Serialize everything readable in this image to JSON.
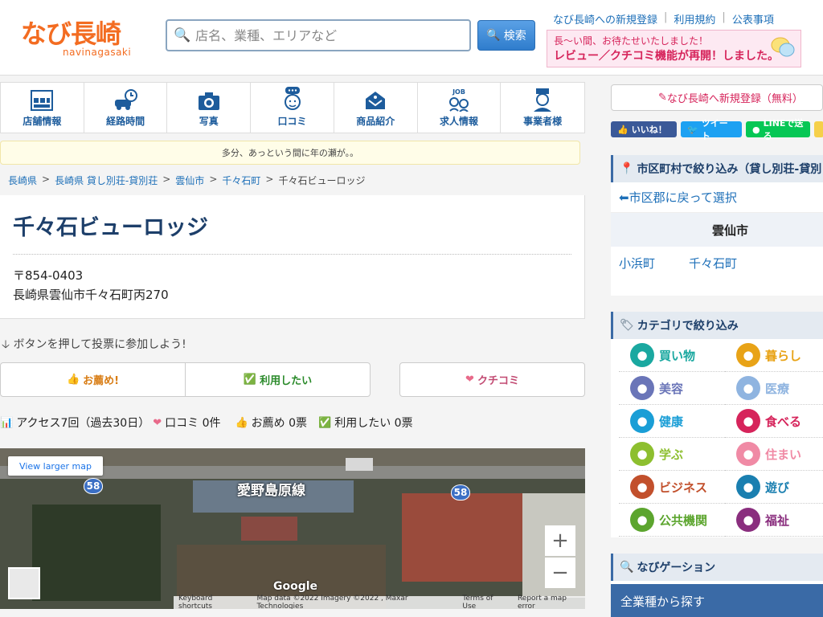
{
  "header": {
    "logo_main": "なび長崎",
    "logo_sub": "navinagasaki",
    "search_placeholder": "店名、業種、エリアなど",
    "search_button": "検索",
    "top_links": [
      "なび長崎への新規登録",
      "利用規約",
      "公表事項"
    ],
    "banner_line1": "長〜い間、お待たせいたしました！",
    "banner_line2": "レビュー／クチコミ機能が再開！しました。"
  },
  "catnav": [
    {
      "label": "店舗情報",
      "icon": "info-icon"
    },
    {
      "label": "経路時間",
      "icon": "car-clock-icon"
    },
    {
      "label": "写真",
      "icon": "camera-icon"
    },
    {
      "label": "口コミ",
      "icon": "speech-person-icon"
    },
    {
      "label": "商品紹介",
      "icon": "product-icon"
    },
    {
      "label": "求人情報",
      "icon": "job-icon"
    },
    {
      "label": "事業者様",
      "icon": "business-person-icon"
    }
  ],
  "notice": "多分、あっという間に年の瀬が。。",
  "breadcrumb": [
    "長崎県",
    "長崎県 貸し別荘-貸別荘",
    "雲仙市",
    "千々石町"
  ],
  "breadcrumb_current": "千々石ビューロッジ",
  "place": {
    "name": "千々石ビューロッジ",
    "zip": "〒854-0403",
    "address": "長崎県雲仙市千々石町丙270"
  },
  "vote": {
    "hint": "ボタンを押して投票に参加しよう!",
    "recommend": "お薦め!",
    "want_use": "利用したい",
    "kuchikomi": "クチコミ"
  },
  "stats": {
    "access": "アクセス7回（過去30日）",
    "kuchikomi": "口コミ 0件",
    "recommend": "お薦め 0票",
    "want_use": "利用したい 0票"
  },
  "map": {
    "larger": "View larger map",
    "road_label": "愛野島原線",
    "shield1": "58",
    "shield2": "58",
    "zoom_in": "+",
    "zoom_out": "−",
    "google": "Google",
    "footer": [
      "Keyboard shortcuts",
      "Map data ©2022 Imagery ©2022 , Maxar Technologies",
      "Terms of Use",
      "Report a map error"
    ]
  },
  "sidebar": {
    "register": "なび長崎へ新規登録（無料）",
    "social": [
      "いいね！",
      "ツイート",
      "LINEで送る"
    ],
    "area_head": "市区町村で絞り込み（貸し別荘-貸別",
    "back": "⬅市区郡に戻って選択",
    "city": "雲仙市",
    "towns": [
      "小浜町",
      "千々石町"
    ],
    "cat_head": "カテゴリで絞り込み",
    "categories": [
      {
        "label": "買い物",
        "color": "#1aa8a0",
        "icon": "shopping-bag-icon"
      },
      {
        "label": "暮らし",
        "color": "#e8a317",
        "icon": "family-icon"
      },
      {
        "label": "美容",
        "color": "#6a75b8",
        "icon": "beauty-icon"
      },
      {
        "label": "医療",
        "color": "#8fb4e0",
        "icon": "medical-icon"
      },
      {
        "label": "健康",
        "color": "#1a9ed6",
        "icon": "health-icon"
      },
      {
        "label": "食べる",
        "color": "#d6245b",
        "icon": "food-icon"
      },
      {
        "label": "学ぶ",
        "color": "#8dbf2f",
        "icon": "learn-icon"
      },
      {
        "label": "住まい",
        "color": "#f08aa5",
        "icon": "house-icon"
      },
      {
        "label": "ビジネス",
        "color": "#c2502c",
        "icon": "building-icon"
      },
      {
        "label": "遊び",
        "color": "#1a7fb0",
        "icon": "play-icon"
      },
      {
        "label": "公共機関",
        "color": "#5ca52e",
        "icon": "public-icon"
      },
      {
        "label": "福祉",
        "color": "#8a2e7e",
        "icon": "welfare-icon"
      }
    ],
    "navi_head": "なびゲーション",
    "all_cat": "全業種から探す"
  }
}
